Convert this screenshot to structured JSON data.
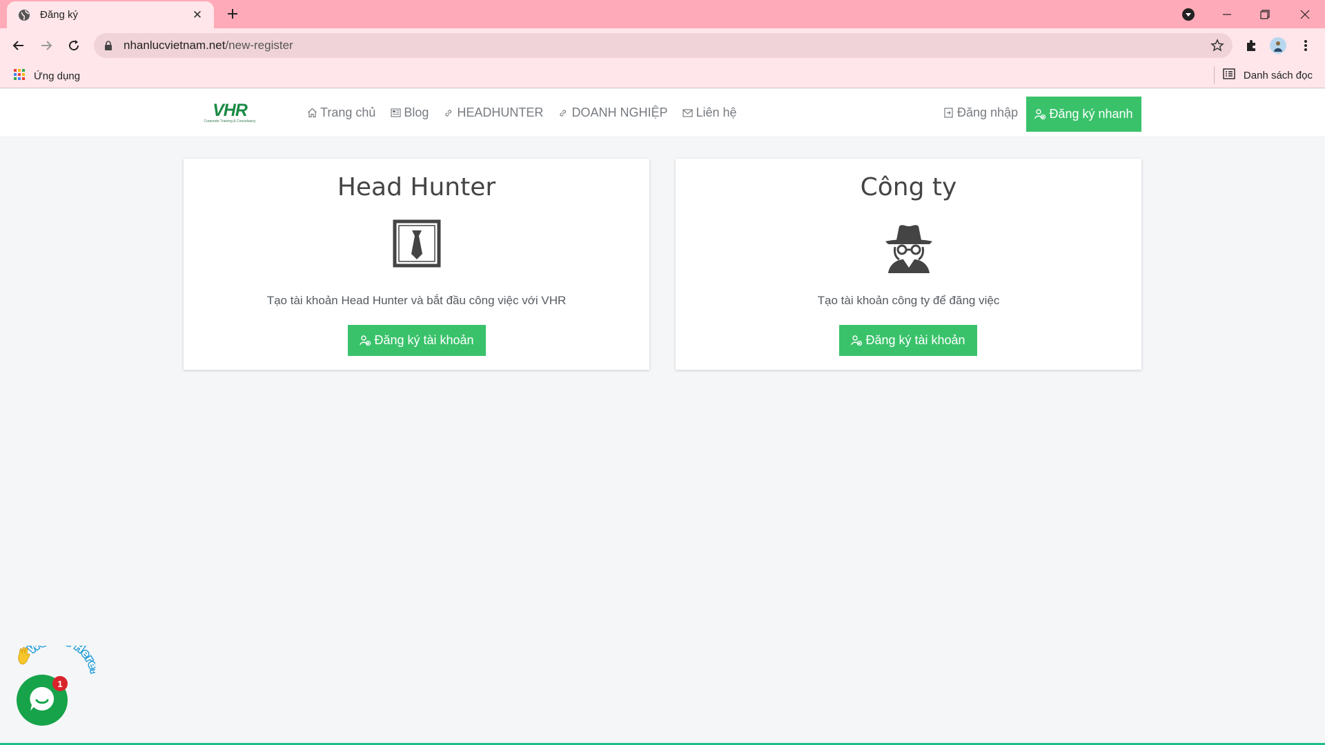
{
  "browser": {
    "tab_title": "Đăng ký",
    "url_domain": "nhanlucvietnam.net",
    "url_path": "/new-register",
    "bookmarks_apps_label": "Ứng dụng",
    "reading_list_label": "Danh sách đọc"
  },
  "site": {
    "logo_text": "VHR",
    "logo_tagline": "Corporate Training & Consultancy",
    "menu": [
      {
        "label": "Trang chủ",
        "icon": "home-icon"
      },
      {
        "label": "Blog",
        "icon": "newspaper-icon"
      },
      {
        "label": "HEADHUNTER",
        "icon": "link-icon"
      },
      {
        "label": "DOANH NGHIỆP",
        "icon": "link-icon"
      },
      {
        "label": "Liên hệ",
        "icon": "mail-icon"
      }
    ],
    "login_label": "Đăng nhập",
    "quick_register_label": "Đăng ký nhanh"
  },
  "cards": [
    {
      "title": "Head Hunter",
      "icon": "tie-icon",
      "description": "Tạo tài khoản Head Hunter và bắt đầu công việc với VHR",
      "button_label": "Đăng ký tài khoản"
    },
    {
      "title": "Công ty",
      "icon": "spy-icon",
      "description": "Tạo tài khoản công ty để đăng việc",
      "button_label": "Đăng ký tài khoản"
    }
  ],
  "chat": {
    "badge_count": "1",
    "caption": "We Are Here!"
  },
  "colors": {
    "accent_green": "#3ac26b",
    "chrome_pink": "#ffaab8",
    "chat_green": "#17a34a"
  }
}
